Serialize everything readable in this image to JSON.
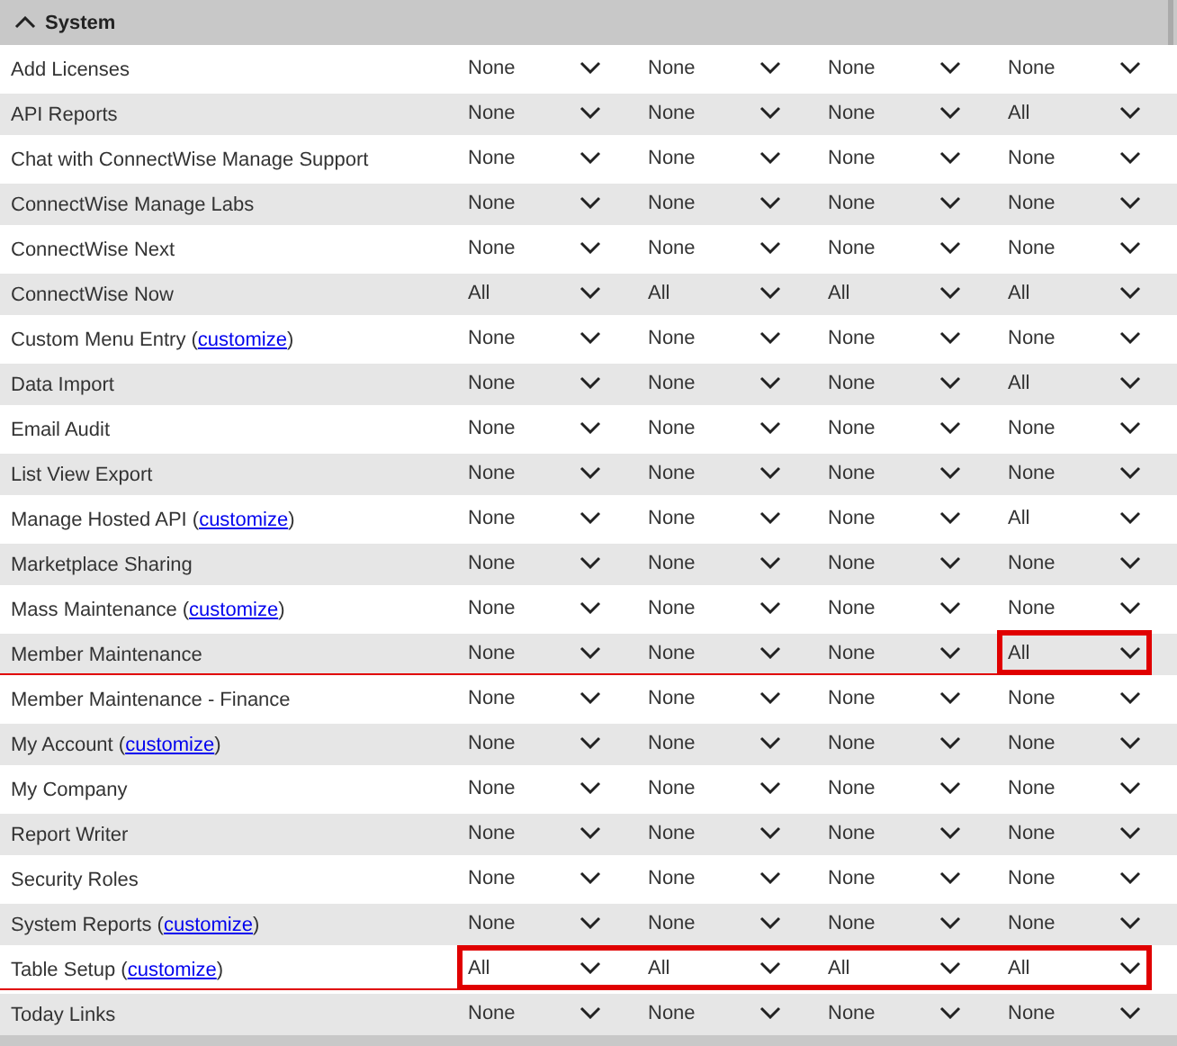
{
  "section": {
    "title": "System",
    "expanded": true
  },
  "rows": [
    {
      "label": "Add Licenses",
      "cells": [
        {
          "value": "None"
        },
        {
          "value": "None"
        },
        {
          "value": "None"
        },
        {
          "value": "None"
        }
      ]
    },
    {
      "label": "API Reports",
      "cells": [
        {
          "value": "None"
        },
        {
          "value": "None"
        },
        {
          "value": "None"
        },
        {
          "value": "All"
        }
      ]
    },
    {
      "label": "Chat with ConnectWise Manage Support",
      "cells": [
        {
          "value": "None"
        },
        {
          "value": "None"
        },
        {
          "value": "None"
        },
        {
          "value": "None"
        }
      ]
    },
    {
      "label": "ConnectWise Manage Labs",
      "cells": [
        {
          "value": "None"
        },
        {
          "value": "None"
        },
        {
          "value": "None"
        },
        {
          "value": "None"
        }
      ]
    },
    {
      "label": "ConnectWise Next",
      "cells": [
        {
          "value": "None"
        },
        {
          "value": "None"
        },
        {
          "value": "None"
        },
        {
          "value": "None"
        }
      ]
    },
    {
      "label": "ConnectWise Now",
      "cells": [
        {
          "value": "All"
        },
        {
          "value": "All"
        },
        {
          "value": "All"
        },
        {
          "value": "All"
        }
      ]
    },
    {
      "label": "Custom Menu Entry (",
      "link": "customize",
      "label_after": ")",
      "cells": [
        {
          "value": "None"
        },
        {
          "value": "None"
        },
        {
          "value": "None"
        },
        {
          "value": "None"
        }
      ]
    },
    {
      "label": "Data Import",
      "cells": [
        {
          "value": "None"
        },
        {
          "value": "None"
        },
        {
          "value": "None"
        },
        {
          "value": "All"
        }
      ]
    },
    {
      "label": "Email Audit",
      "cells": [
        {
          "value": "None"
        },
        {
          "value": "None"
        },
        {
          "value": "None"
        },
        {
          "value": "None"
        }
      ]
    },
    {
      "label": "List View Export",
      "cells": [
        {
          "value": "None"
        },
        {
          "value": "None"
        },
        {
          "value": "None"
        },
        {
          "value": "None"
        }
      ]
    },
    {
      "label": "Manage Hosted API (",
      "link": "customize",
      "label_after": ")",
      "cells": [
        {
          "value": "None"
        },
        {
          "value": "None"
        },
        {
          "value": "None"
        },
        {
          "value": "All"
        }
      ]
    },
    {
      "label": "Marketplace Sharing",
      "cells": [
        {
          "value": "None"
        },
        {
          "value": "None"
        },
        {
          "value": "None"
        },
        {
          "value": "None"
        }
      ]
    },
    {
      "label": "Mass Maintenance (",
      "link": "customize",
      "label_after": ")",
      "cells": [
        {
          "value": "None"
        },
        {
          "value": "None"
        },
        {
          "value": "None"
        },
        {
          "value": "None"
        }
      ]
    },
    {
      "label": "Member Maintenance",
      "underlined": true,
      "cells": [
        {
          "value": "None"
        },
        {
          "value": "None"
        },
        {
          "value": "None"
        },
        {
          "value": "All",
          "highlighted": true
        }
      ]
    },
    {
      "label": "Member Maintenance - Finance",
      "cells": [
        {
          "value": "None"
        },
        {
          "value": "None"
        },
        {
          "value": "None"
        },
        {
          "value": "None"
        }
      ]
    },
    {
      "label": "My Account (",
      "link": "customize",
      "label_after": ")",
      "cells": [
        {
          "value": "None"
        },
        {
          "value": "None"
        },
        {
          "value": "None"
        },
        {
          "value": "None"
        }
      ]
    },
    {
      "label": "My Company",
      "cells": [
        {
          "value": "None"
        },
        {
          "value": "None"
        },
        {
          "value": "None"
        },
        {
          "value": "None"
        }
      ]
    },
    {
      "label": "Report Writer",
      "cells": [
        {
          "value": "None"
        },
        {
          "value": "None"
        },
        {
          "value": "None"
        },
        {
          "value": "None"
        }
      ]
    },
    {
      "label": "Security Roles",
      "cells": [
        {
          "value": "None"
        },
        {
          "value": "None"
        },
        {
          "value": "None"
        },
        {
          "value": "None"
        }
      ]
    },
    {
      "label": "System Reports (",
      "link": "customize",
      "label_after": ")",
      "cells": [
        {
          "value": "None"
        },
        {
          "value": "None"
        },
        {
          "value": "None"
        },
        {
          "value": "None"
        }
      ]
    },
    {
      "label": "Table Setup (",
      "link": "customize",
      "label_after": ")",
      "underlined": true,
      "cells": [
        {
          "value": "All",
          "highlighted": true
        },
        {
          "value": "All",
          "highlighted": true
        },
        {
          "value": "All",
          "highlighted": true
        },
        {
          "value": "All",
          "highlighted": true
        }
      ]
    },
    {
      "label": "Today Links",
      "cells": [
        {
          "value": "None"
        },
        {
          "value": "None"
        },
        {
          "value": "None"
        },
        {
          "value": "None"
        }
      ]
    }
  ]
}
